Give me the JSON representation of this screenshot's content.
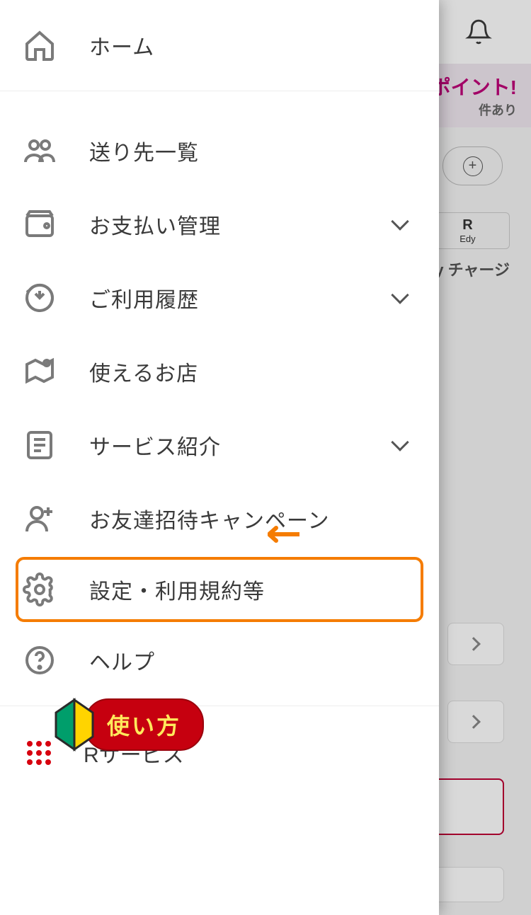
{
  "background": {
    "banner_text": "ポイント!",
    "banner_sub": "件あり",
    "edy_logo_top": "R",
    "edy_logo_bottom": "Edy",
    "edy_charge_label": "dy チャージ"
  },
  "menu": {
    "home": "ホーム",
    "recipients": "送り先一覧",
    "payment": "お支払い管理",
    "history": "ご利用履歴",
    "stores": "使えるお店",
    "services": "サービス紹介",
    "invite": "お友達招待キャンペーン",
    "settings": "設定・利用規約等",
    "help": "ヘルプ",
    "r_service": "Rサービス"
  },
  "tutorial_badge": "使い方"
}
